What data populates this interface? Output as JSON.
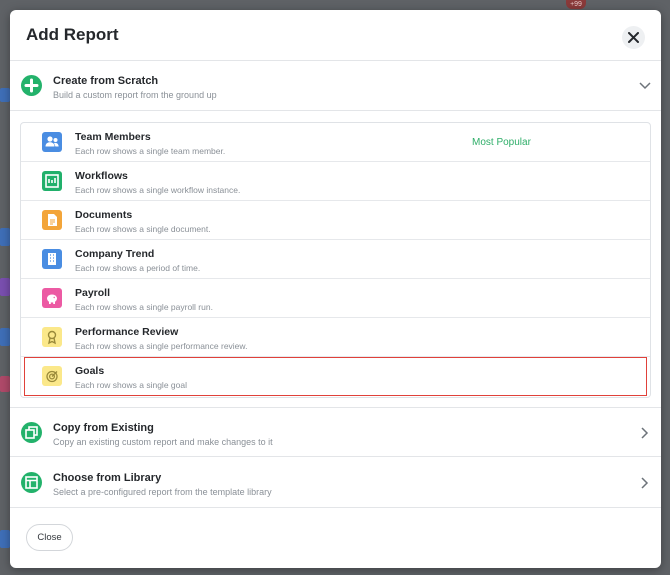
{
  "backdrop": {
    "badge": "+99"
  },
  "modal": {
    "title": "Add Report",
    "close_icon": "close-icon"
  },
  "sections": {
    "scratch": {
      "title": "Create from Scratch",
      "subtitle": "Build a custom report from the ground up",
      "icon": "plus-circle-icon",
      "chevron": "chevron-down-icon"
    },
    "copy": {
      "title": "Copy from Existing",
      "subtitle": "Copy an existing custom report and make changes to it",
      "icon": "copy-icon",
      "chevron": "chevron-right-icon"
    },
    "library": {
      "title": "Choose from Library",
      "subtitle": "Select a pre-configured report from the template library",
      "icon": "layout-icon",
      "chevron": "chevron-right-icon"
    }
  },
  "report_types": [
    {
      "title": "Team Members",
      "subtitle": "Each row shows a single team member.",
      "badge": "Most Popular",
      "icon": "team-icon",
      "color": "#4a8de2"
    },
    {
      "title": "Workflows",
      "subtitle": "Each row shows a single workflow instance.",
      "icon": "workflow-icon",
      "color": "#21b06b"
    },
    {
      "title": "Documents",
      "subtitle": "Each row shows a single document.",
      "icon": "document-icon",
      "color": "#f3a53a"
    },
    {
      "title": "Company Trend",
      "subtitle": "Each row shows a period of time.",
      "icon": "building-icon",
      "color": "#4a8de2"
    },
    {
      "title": "Payroll",
      "subtitle": "Each row shows a single payroll run.",
      "icon": "piggy-bank-icon",
      "color": "#ec5aa3"
    },
    {
      "title": "Performance Review",
      "subtitle": "Each row shows a single performance review.",
      "icon": "award-icon",
      "color": "#fbe88a"
    },
    {
      "title": "Goals",
      "subtitle": "Each row shows a single goal",
      "icon": "target-icon",
      "color": "#fbe88a",
      "selected": true
    }
  ],
  "footer": {
    "close_label": "Close"
  },
  "colors": {
    "accent": "#23b26b",
    "selection": "#e0413a",
    "popular": "#2fae69"
  }
}
